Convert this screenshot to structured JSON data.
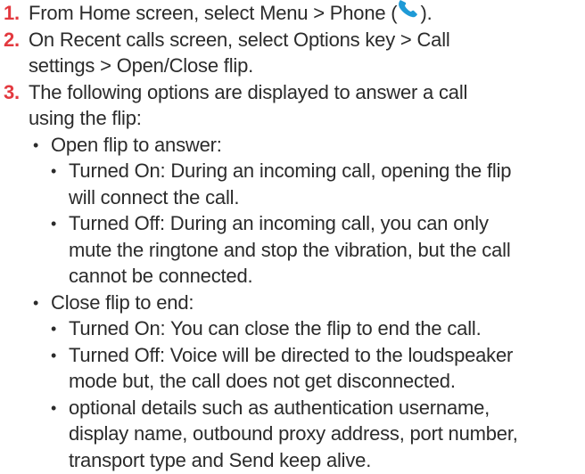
{
  "steps": [
    {
      "number": "1.",
      "lines": [
        {
          "before_icon": "From Home screen, select Menu > Phone   (",
          "after_icon": ")."
        }
      ],
      "icon": "phone-icon"
    },
    {
      "number": "2.",
      "lines": [
        "On Recent calls screen, select Options key > Call",
        "settings > Open/Close flip."
      ]
    },
    {
      "number": "3.",
      "lines": [
        "The following options are displayed to answer a call",
        "using the flip:"
      ],
      "options": [
        {
          "label": "Open flip to answer:",
          "items": [
            {
              "lines": [
                "Turned On: During an incoming call, opening the flip",
                "will connect the call."
              ]
            },
            {
              "lines": [
                "Turned Off: During an incoming call, you can only",
                "mute the ringtone and stop the vibration, but the call",
                "cannot be connected."
              ]
            }
          ]
        },
        {
          "label": "Close flip to end:",
          "items": [
            {
              "lines": [
                "Turned On: You can close the flip to end the call."
              ]
            },
            {
              "lines": [
                "Turned Off: Voice will be directed to the loudspeaker",
                "mode but, the call does not get disconnected."
              ]
            },
            {
              "lines": [
                "optional details such as authentication username,",
                "display name, outbound proxy address, port number,",
                "transport type and Send keep alive."
              ]
            }
          ]
        }
      ]
    }
  ],
  "colors": {
    "step_number": "#e3393f",
    "text": "#2b2b2b",
    "icon": "#1e9ad6"
  },
  "bullet_glyph": "•"
}
